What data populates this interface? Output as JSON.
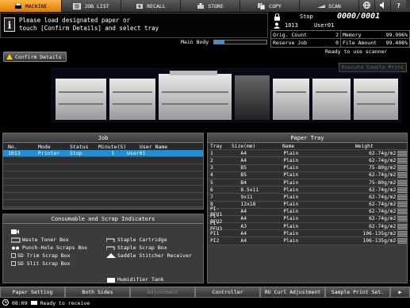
{
  "tabs": [
    {
      "label": "MACHINE",
      "icon": "printer-icon",
      "active": true
    },
    {
      "label": "JOB LIST",
      "icon": "list-icon",
      "active": false
    },
    {
      "label": "RECALL",
      "icon": "recall-icon",
      "active": false
    },
    {
      "label": "STORE",
      "icon": "store-icon",
      "active": false
    },
    {
      "label": "COPY",
      "icon": "copy-icon",
      "active": false
    },
    {
      "label": "SCAN",
      "icon": "scan-icon",
      "active": false
    }
  ],
  "message": {
    "line1": "Please load designated paper or",
    "line2": "touch [Confirm Details] and select tray"
  },
  "main_body": {
    "label": "Main Body",
    "progress": 0.2
  },
  "status": {
    "state": "Stop",
    "counter": "0000/0001",
    "job_id": "1013",
    "user": "User01"
  },
  "counts": {
    "orig_count_label": "Orig. Count",
    "orig_count": "2",
    "memory_label": "Memory",
    "memory": "99.996%",
    "reserve_label": "Reserve Job",
    "reserve": "0",
    "file_amount_label": "File Amount",
    "file_amount": "99.408%"
  },
  "ready_text": "Ready to use scanner",
  "confirm_label": "Confirm Details",
  "exec_label": "Execute Sample Print",
  "job": {
    "title": "Job",
    "headers": [
      "No.",
      "Mode",
      "Status",
      "Minute(S)",
      "User Name"
    ],
    "rows": [
      [
        "1013",
        "Printer",
        "Stop",
        "1",
        "User01"
      ]
    ]
  },
  "paper_tray": {
    "title": "Paper Tray",
    "headers": [
      "Tray",
      "Size(mm)",
      "Name",
      "Weight"
    ],
    "rows": [
      [
        "1",
        "A4",
        "Plain",
        "62-74g/m2"
      ],
      [
        "2",
        "A4",
        "Plain",
        "62-74g/m2"
      ],
      [
        "3",
        "B5",
        "Plain",
        "75-80g/m2"
      ],
      [
        "4",
        "B5",
        "Plain",
        "62-74g/m2"
      ],
      [
        "5",
        "B4",
        "Plain",
        "75-80g/m2"
      ],
      [
        "6",
        "8.5x11",
        "Plain",
        "62-74g/m2"
      ],
      [
        "7",
        "9x11",
        "Plain",
        "62-74g/m2"
      ],
      [
        "8",
        "12x18",
        "Plain",
        "62-74g/m2"
      ],
      [
        "PI-PFU1",
        "A4",
        "Plain",
        "62-74g/m2"
      ],
      [
        "PI-PFU2",
        "A4",
        "Plain",
        "62-74g/m2"
      ],
      [
        "PI-PFU3",
        "A3",
        "Plain",
        "62-74g/m2"
      ],
      [
        "PI1",
        "A4",
        "Plain",
        "106-135g/m2"
      ],
      [
        "PI2",
        "A4",
        "Plain",
        "106-135g/m2"
      ]
    ]
  },
  "consumables": {
    "title": "Consumable and Scrap Indicators",
    "waste_toner": "Waste Toner Box",
    "punch": "Punch-Hole Scraps Box",
    "sd_trim": "SD Trim Scrap Box",
    "sd_slit": "SD Slit Scrap Box",
    "staple_cart": "Staple Cartridge",
    "staple_scrap": "Staple Scrap Box",
    "saddle": "Saddle Stitcher Receiver",
    "humidifier": "Humidifier Tank"
  },
  "bottom": [
    "Paper Setting",
    "Both Sides",
    "Adjustment",
    "Controller",
    "RU Curl Adjustment",
    "Sample Print Set."
  ],
  "clock": "08:09",
  "receive": "Ready to receive"
}
